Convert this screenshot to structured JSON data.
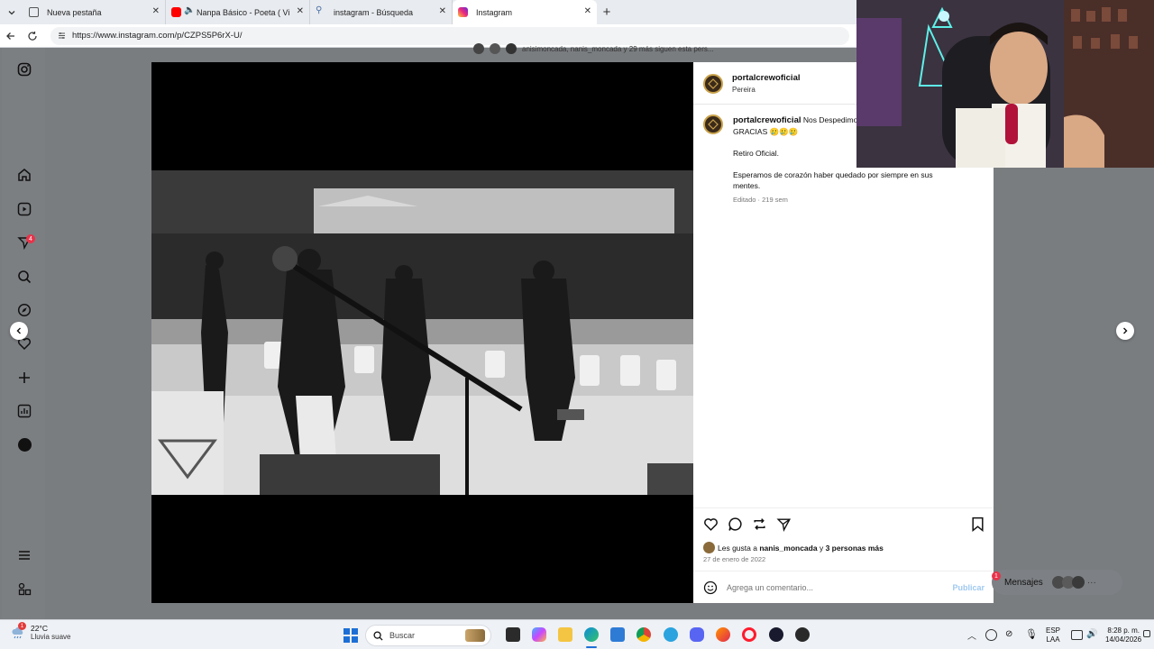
{
  "browser": {
    "tabs": [
      {
        "label": "Nueva pestaña",
        "favicon_color": "#5b6b7b",
        "active": false
      },
      {
        "label": "Nanpa Básico - Poeta ( Video",
        "favicon_color": "#ff0000",
        "active": false
      },
      {
        "label": "instagram - Búsqueda",
        "favicon_color": "#4a6fa5",
        "active": false
      },
      {
        "label": "Instagram",
        "favicon_color": "#d6249f",
        "active": true
      }
    ],
    "new_tab_symbol": "+",
    "url": "https://www.instagram.com/p/CZPS5P6rX-U/"
  },
  "post": {
    "header": {
      "username": "portalcrewoficial",
      "location": "Pereira"
    },
    "caption": {
      "username": "portalcrewoficial",
      "text_line1": "Nos Despedimos",
      "text_line2": "GRACIAS 🥲🥲🥲",
      "paragraph2": "Retiro Oficial.",
      "paragraph3": "Esperamos de corazón haber quedado por siempre en sus mentes.",
      "meta": "Editado · 219 sem"
    },
    "likes": {
      "prefix": "Les gusta a",
      "user": "nanis_moncada",
      "connector": "y",
      "others": "3 personas más"
    },
    "date": "27 de enero de 2022",
    "comment_placeholder": "Agrega un comentario...",
    "publish_label": "Publicar"
  },
  "top_strip_text": "anisimoncada, nanis_moncada y 29 más siguen esta pers...",
  "messages": {
    "label": "Mensajes",
    "badge": "1"
  },
  "leftnav": {
    "notifications_badge": "4"
  },
  "taskbar": {
    "weather_temp": "22°C",
    "weather_desc": "Lluvia suave",
    "search_placeholder": "Buscar",
    "lang_top": "ESP",
    "lang_bottom": "LAA",
    "time": "8:28 p. m.",
    "date": "14/04/2026"
  },
  "colors": {
    "instagram_pink": "#d6249f",
    "badge_red": "#e8334a",
    "link_blue": "#0095f6"
  }
}
